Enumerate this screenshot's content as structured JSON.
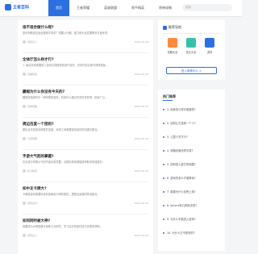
{
  "header": {
    "logo_text": "王者百科",
    "nav": [
      "首页",
      "王者荣耀",
      "英雄联盟",
      "和平精英",
      "原神攻略",
      "游戏资讯"
    ],
    "active_index": 0,
    "search_placeholder": "搜索"
  },
  "posts": [
    {
      "title": "适不适合做什么呢?",
      "desc": "如何判断是否适合做某件事情？需要从兴趣、能力和长远发展等多方面考虑。",
      "author": "游戏达人",
      "date": "2022-06-18"
    },
    {
      "title": "全体厅怎么样才行?",
      "desc": "1. 每位玩家需要进入游戏并按照规则进行操作，完成任务后即可获得奖励。",
      "author": "英雄联盟",
      "date": "2022-06-18"
    },
    {
      "title": "藏缎为什么你没有今天的?",
      "desc": "藏缎是指游戏中一种特殊的道具，玩家可以通过完成任务获得，用途广泛。",
      "author": "原神攻略",
      "date": "2022-06-18"
    },
    {
      "title": "周边百度一个团的?",
      "desc": "团队合作是游戏获胜的关键，玩家之间需要保持良好的沟通与配合。",
      "author": "王者荣耀",
      "date": "2022-06-18"
    },
    {
      "title": "手游大气起的掌握?",
      "desc": "在手游中掌握大气的节奏非常重要，合理安排资源能够帮助你快速提升。",
      "author": "和平精英",
      "date": "2022-06-18"
    },
    {
      "title": "如中支卡牌大?",
      "desc": "卡牌类游戏需要玩家熟悉每张卡牌的属性，搭配出最强的阵容组合。",
      "author": "游戏资讯",
      "date": "2022-06-18"
    },
    {
      "title": "如何同时被大神?",
      "desc": "想要成为大神需要大量练习与研究，学习高手的操作技巧也很有帮助。",
      "author": "游戏达人",
      "date": "2022-06-18"
    }
  ],
  "side_card": {
    "title": "推荐导航",
    "tiles": [
      {
        "label": "攻略大全",
        "color": "#ff8a3d"
      },
      {
        "label": "英文大全",
        "color": "#36c0a8"
      },
      {
        "label": "游戏",
        "color": "#2c6fe0"
      }
    ],
    "cta_label": "进入推荐中心 >"
  },
  "hot_card": {
    "title": "热门推荐",
    "items": [
      "1. 玩家怎么样才能登陆?",
      "2. 如何让它选择一个人?",
      "3. 儿童十岁才行?",
      "4. 攻略页面怎样中奖?",
      "5. 如何进入官方的地图?",
      "6. 游戏内怎么才能联动?",
      "7. 英雄为什么没有上线?",
      "8. Iphone有几种玩法的?",
      "9. 为什么不能进入游戏?",
      "10. 为什么它不是好的?"
    ]
  }
}
